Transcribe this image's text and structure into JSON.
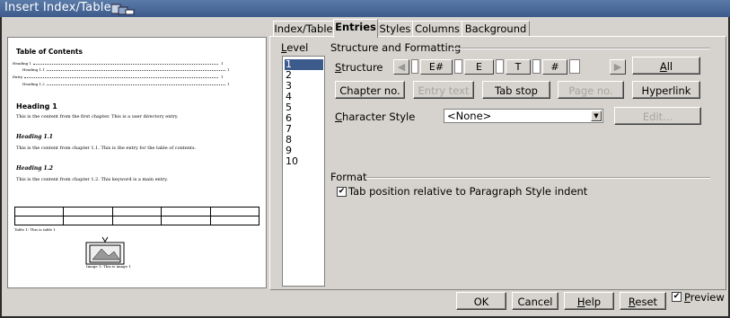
{
  "window": {
    "title": "Insert Index/Table"
  },
  "preview": {
    "toc_title": "Table of Contents",
    "toc_entries": [
      {
        "text": "Heading 1",
        "page": "1"
      },
      {
        "text": "Heading 1.1",
        "page": "1"
      },
      {
        "text": "Entry",
        "page": "1"
      },
      {
        "text": "Heading 1.2",
        "page": "1"
      }
    ],
    "heading1": "Heading 1",
    "para1": "This is the content from the first chapter. This is a user directory entry.",
    "heading11": "Heading 1.1",
    "para11": "This is the content from chapter 1.1. This is the entry for the table of contents.",
    "heading12": "Heading 1.2",
    "para12": "This is the content from chapter 1.2. This keyword is a main entry.",
    "table_caption": "Table 1: This is table 1",
    "image_caption": "Image 1: This is image 1"
  },
  "tabs": [
    {
      "label": "Index/Table",
      "active": false
    },
    {
      "label": "Entries",
      "active": true
    },
    {
      "label": "Styles",
      "active": false
    },
    {
      "label": "Columns",
      "active": false
    },
    {
      "label": "Background",
      "active": false
    }
  ],
  "level": {
    "label": "Level",
    "items": [
      "1",
      "2",
      "3",
      "4",
      "5",
      "6",
      "7",
      "8",
      "9",
      "10"
    ],
    "selected": "1"
  },
  "structure_formatting": {
    "group_label": "Structure and Formatting",
    "structure_label": "Structure",
    "tokens": [
      "E#",
      "E",
      "T",
      "#"
    ],
    "all_button": "All",
    "chapter_no_button": "Chapter no.",
    "entry_text_button": "Entry text",
    "tab_stop_button": "Tab stop",
    "page_no_button": "Page no.",
    "hyperlink_button": "Hyperlink",
    "char_style_label": "Character Style",
    "char_style_value": "<None>",
    "edit_button": "Edit..."
  },
  "format": {
    "group_label": "Format",
    "tab_position_label": "Tab position relative to Paragraph Style indent",
    "tab_position_checked": true
  },
  "footer": {
    "ok": "OK",
    "cancel": "Cancel",
    "help": "Help",
    "reset": "Reset",
    "preview_label": "Preview",
    "preview_checked": true
  },
  "colors": {
    "titlebar": "#3c5b8c",
    "dialog_bg": "#d6d3ce",
    "selection": "#3c5b8c"
  }
}
